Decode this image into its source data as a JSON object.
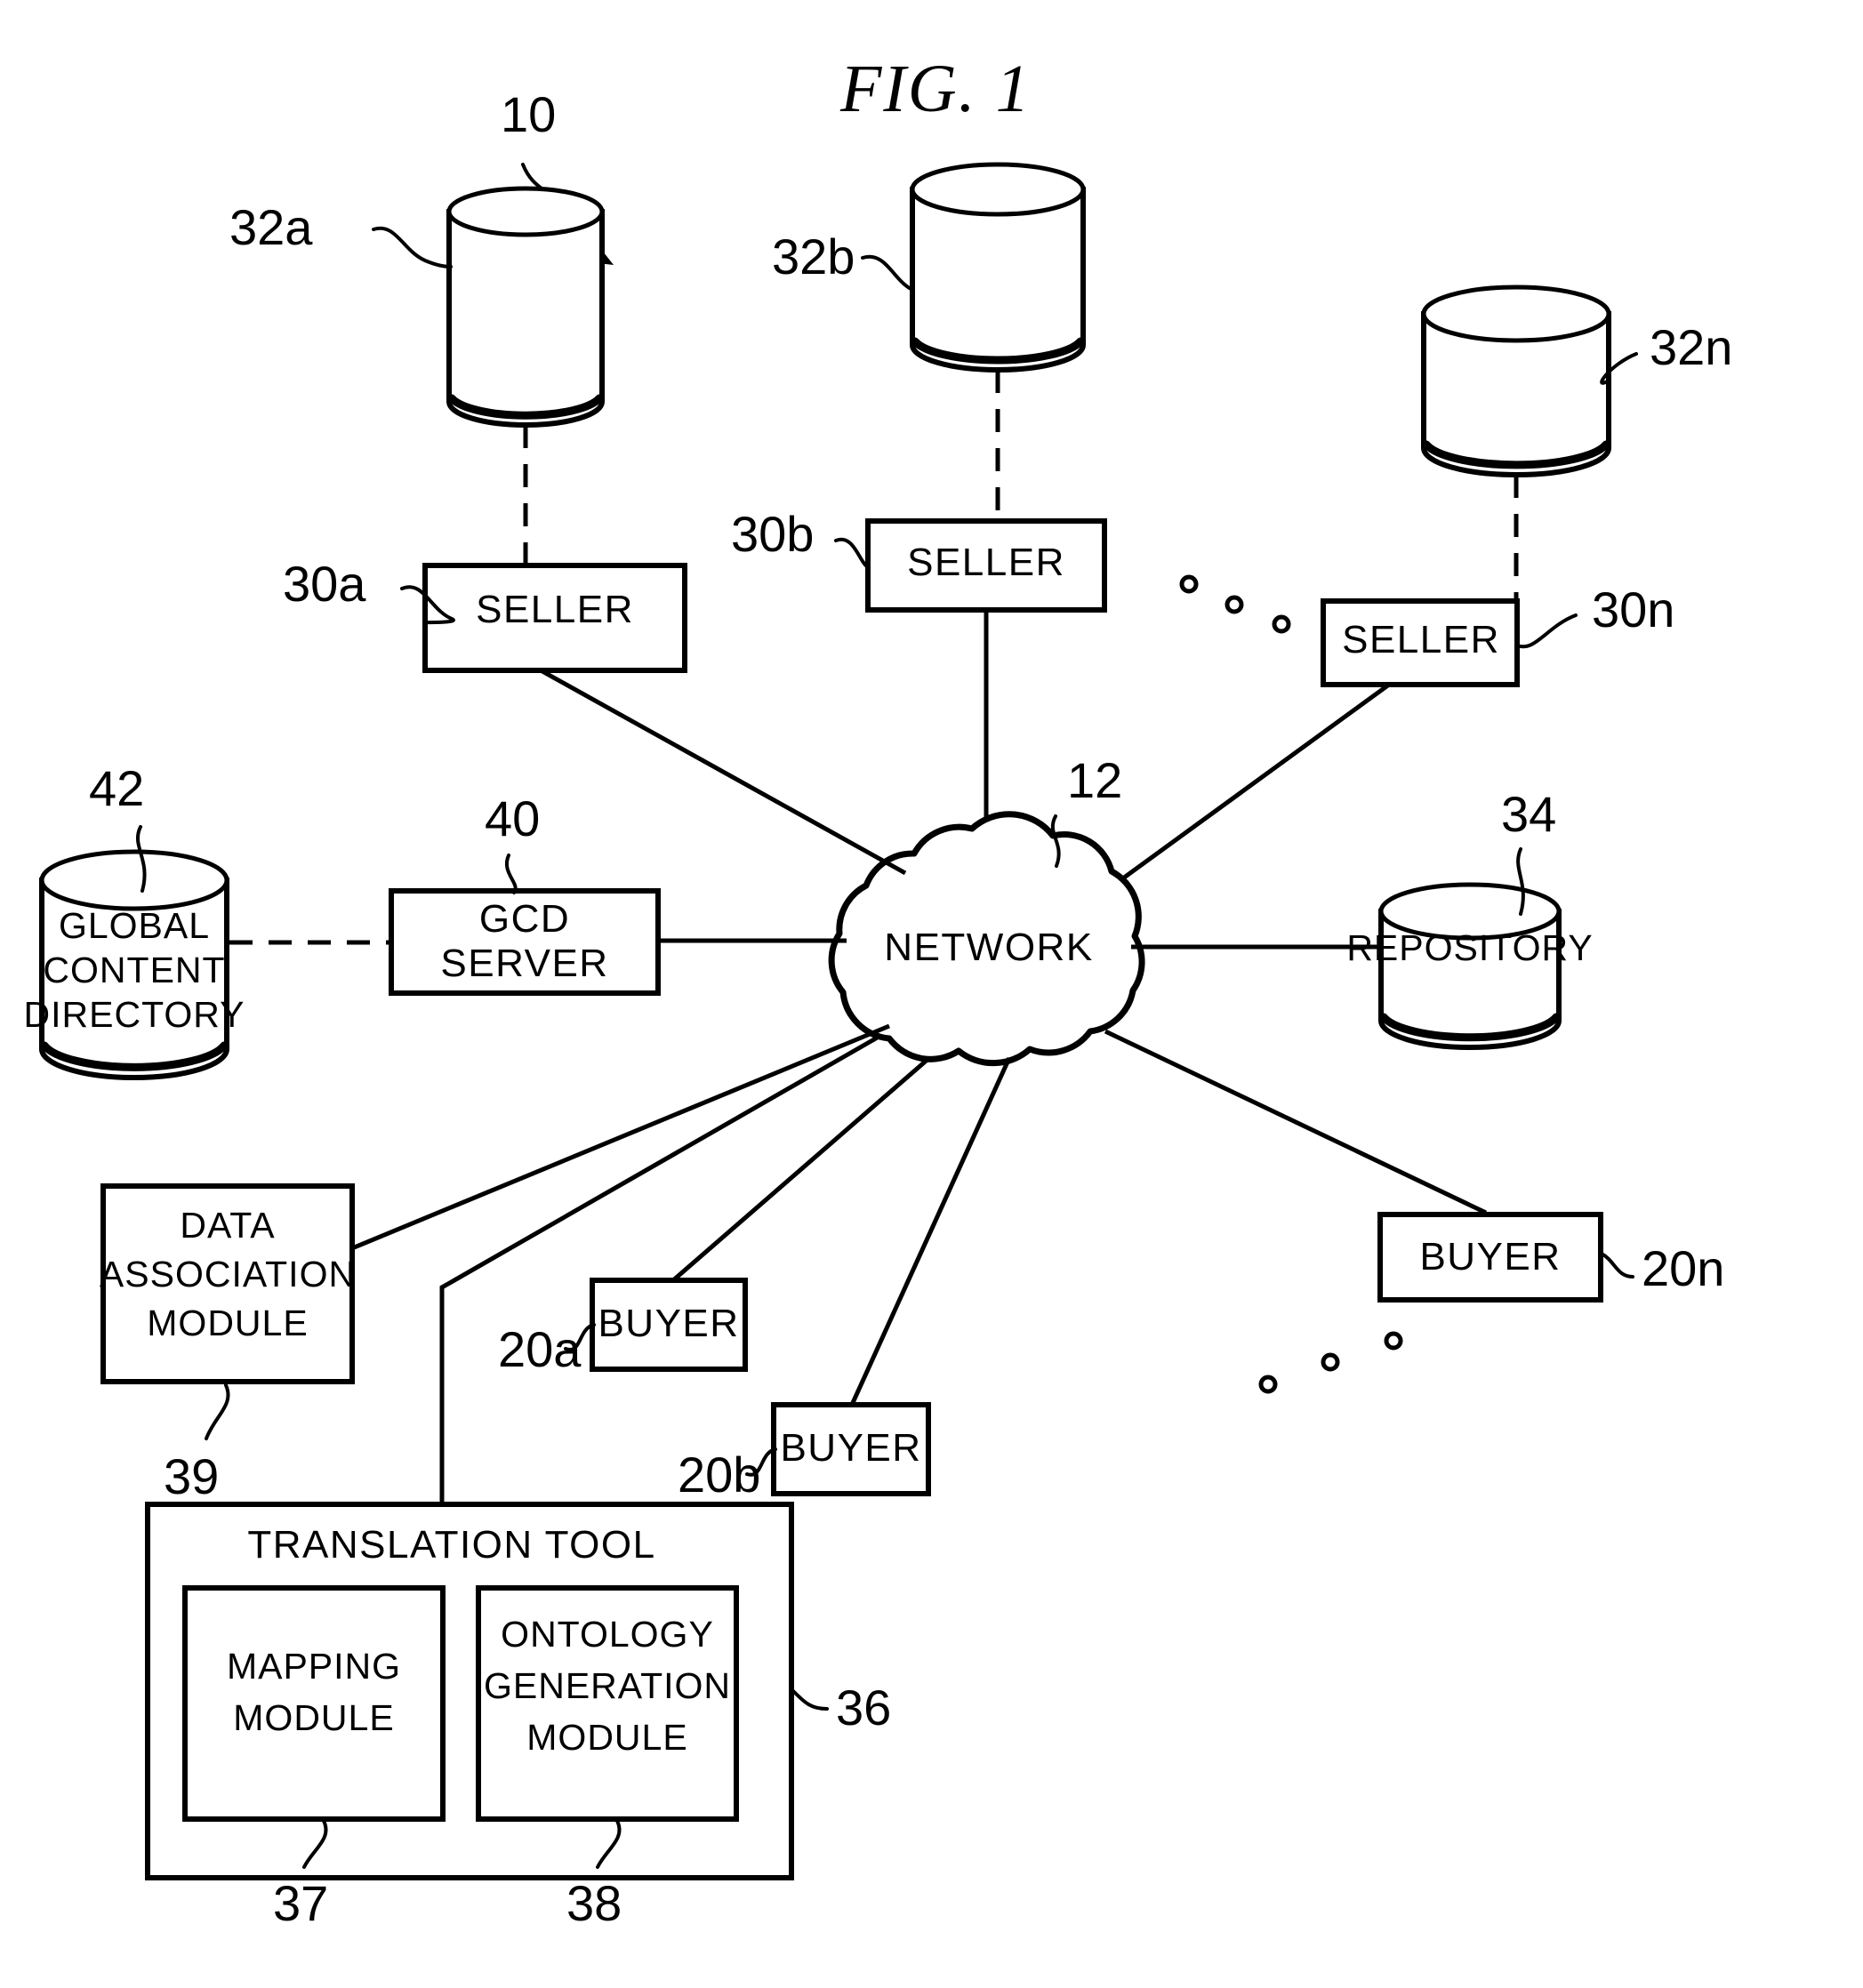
{
  "figure": {
    "title": "FIG.  1",
    "system_ref": "10"
  },
  "nodes": {
    "seller_a": {
      "label": "SELLER",
      "ref": "30a"
    },
    "seller_b": {
      "label": "SELLER",
      "ref": "30b"
    },
    "seller_n": {
      "label": "SELLER",
      "ref": "30n"
    },
    "db_a": {
      "ref": "32a"
    },
    "db_b": {
      "ref": "32b"
    },
    "db_n": {
      "ref": "32n"
    },
    "network": {
      "label": "NETWORK",
      "ref": "12"
    },
    "repository": {
      "label": "REPOSITORY",
      "ref": "34"
    },
    "gcd_server": {
      "label_line1": "GCD",
      "label_line2": "SERVER",
      "ref": "40"
    },
    "global_content_directory": {
      "label_line1": "GLOBAL",
      "label_line2": "CONTENT",
      "label_line3": "DIRECTORY",
      "ref": "42"
    },
    "data_association_module": {
      "label_line1": "DATA",
      "label_line2": "ASSOCIATION",
      "label_line3": "MODULE",
      "ref": "39"
    },
    "buyer_a": {
      "label": "BUYER",
      "ref": "20a"
    },
    "buyer_b": {
      "label": "BUYER",
      "ref": "20b"
    },
    "buyer_n": {
      "label": "BUYER",
      "ref": "20n"
    },
    "translation_tool": {
      "label": "TRANSLATION TOOL",
      "ref": "36"
    },
    "mapping_module": {
      "label_line1": "MAPPING",
      "label_line2": "MODULE",
      "ref": "37"
    },
    "ontology_generation_module": {
      "label_line1": "ONTOLOGY",
      "label_line2": "GENERATION",
      "label_line3": "MODULE",
      "ref": "38"
    }
  },
  "colors": {
    "ink": "#000000",
    "paper": "#ffffff"
  }
}
